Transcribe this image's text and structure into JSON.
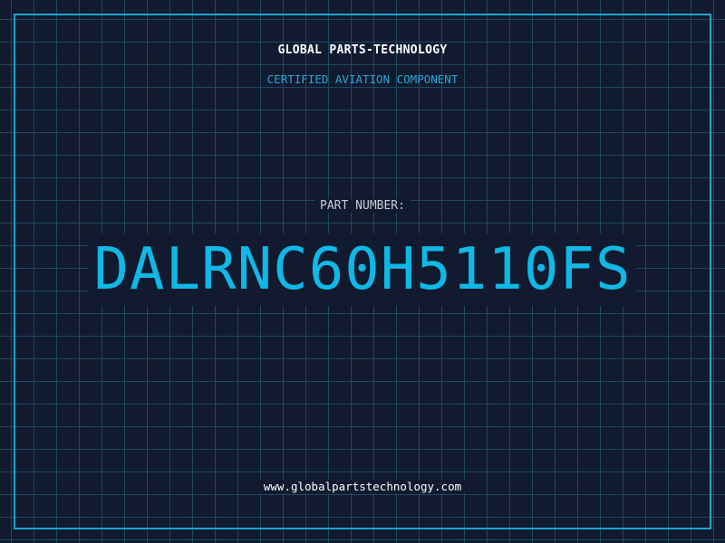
{
  "header": {
    "company_name": "GLOBAL PARTS-TECHNOLOGY",
    "tagline": "CERTIFIED AVIATION COMPONENT"
  },
  "part": {
    "label": "PART NUMBER:",
    "number": "DALRNC60H5110FS"
  },
  "footer": {
    "website": "www.globalpartstechnology.com"
  },
  "colors": {
    "background": "#111a2e",
    "grid": "#1c4a63",
    "accent": "#0fb8e6",
    "frame": "#1ea6cf"
  }
}
